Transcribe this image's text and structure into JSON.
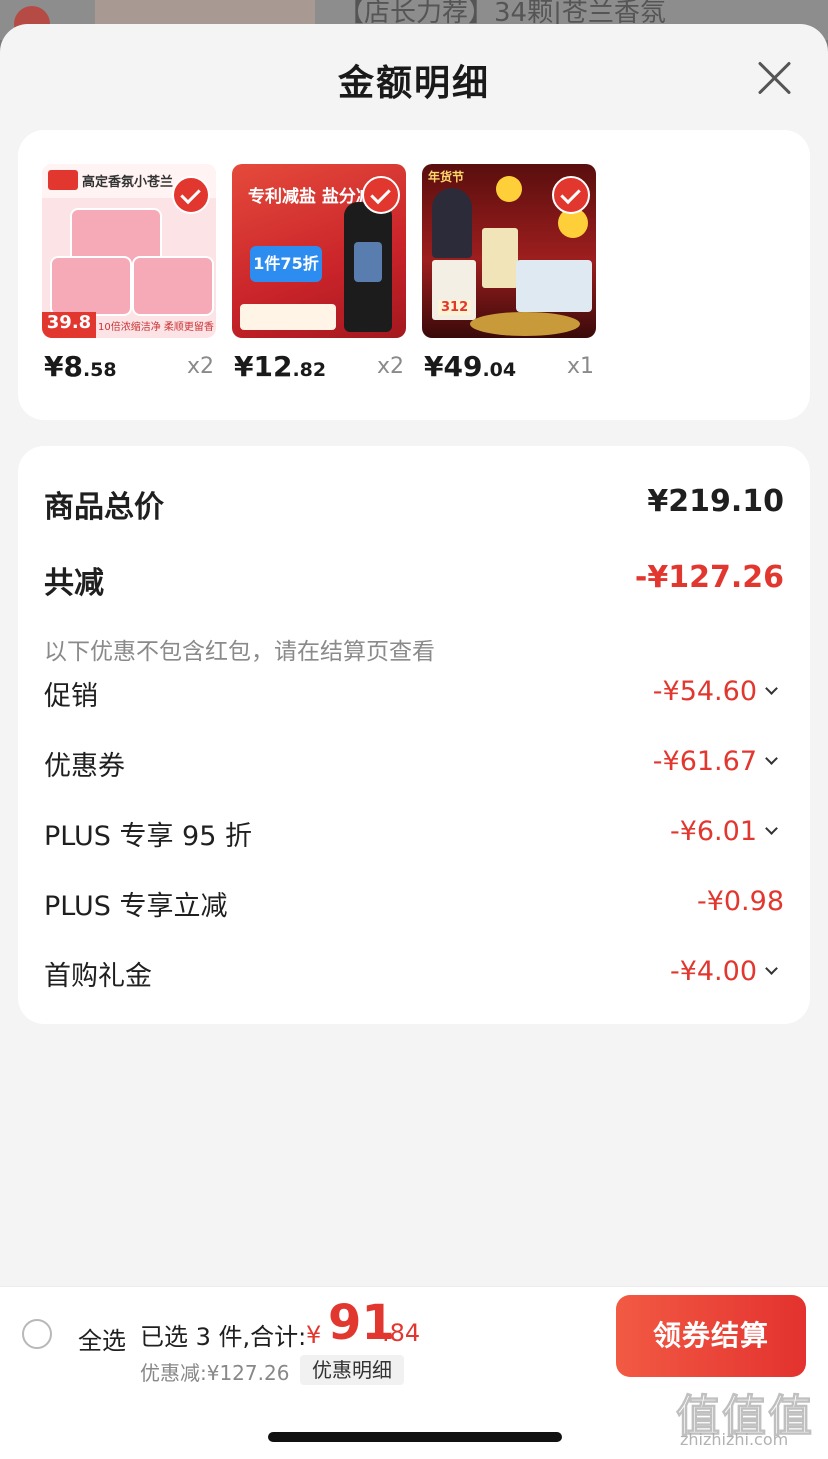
{
  "background": {
    "title_partial": "【店长力荐】34颗|苍兰香氛"
  },
  "sheet": {
    "title": "金额明细",
    "products": [
      {
        "image_label": "高定香氛小苍兰",
        "price_int": "¥8",
        "price_dec": ".58",
        "qty": "x2",
        "image_price": "39.8",
        "image_footer": "10倍浓缩洁净 柔顺更留香"
      },
      {
        "image_label": "专利减盐 盐分减半",
        "price_int": "¥12",
        "price_dec": ".82",
        "qty": "x2",
        "image_badge": "1件75折"
      },
      {
        "image_label": "年货节",
        "price_int": "¥49",
        "price_dec": ".04",
        "qty": "x1",
        "image_price": "312"
      }
    ],
    "summary": {
      "goods_total_label": "商品总价",
      "goods_total_value": "¥219.10",
      "total_discount_label": "共减",
      "total_discount_value": "-¥127.26",
      "note": "以下优惠不包含红包，请在结算页查看",
      "rows": [
        {
          "label": "促销",
          "value": "-¥54.60",
          "expandable": true
        },
        {
          "label": "优惠券",
          "value": "-¥61.67",
          "expandable": true
        },
        {
          "label": "PLUS 专享 95 折",
          "value": "-¥6.01",
          "expandable": true
        },
        {
          "label": "PLUS 专享立减",
          "value": "-¥0.98",
          "expandable": false
        },
        {
          "label": "首购礼金",
          "value": "-¥4.00",
          "expandable": true
        }
      ]
    }
  },
  "bottom_bar": {
    "select_all": "全选",
    "selected_text": "已选 3 件,合计:",
    "currency": "¥",
    "total_int": "91",
    "total_dec": ".84",
    "discount_text": "优惠减:¥127.26",
    "detail_link": "优惠明细",
    "checkout": "领券结算"
  },
  "watermark": {
    "main": "值值值",
    "sub": "zhizhizhi.com"
  },
  "colors": {
    "accent_red": "#e2372f",
    "sheet_bg": "#f4f4f4",
    "card_bg": "#ffffff"
  }
}
